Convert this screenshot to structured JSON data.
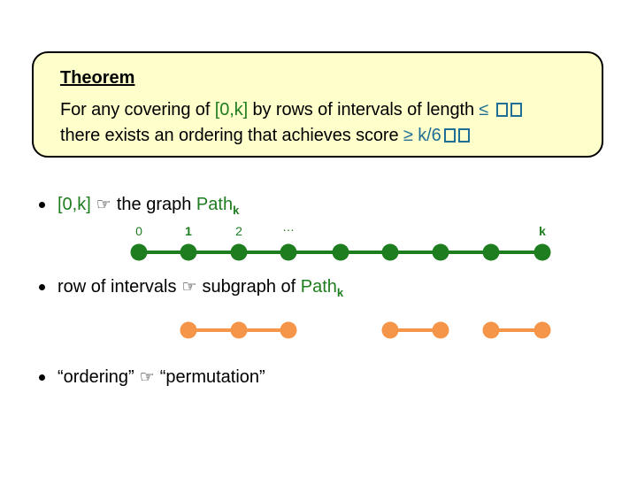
{
  "theorem": {
    "title": "Theorem",
    "line1_prefix": "For any covering of ",
    "line1_interval": "[0,k]",
    "line1_mid": " by rows of intervals of length ",
    "line1_bound": "≤ ",
    "line1_suffix": ",",
    "line2_prefix": "there exists an ordering that achieves score ",
    "line2_bound": "≥ k/6"
  },
  "bullets": [
    {
      "left": "[0,k]",
      "arrow": "☞",
      "right_prefix": "the graph ",
      "right_term": "Path",
      "right_sub": "k"
    },
    {
      "left": "row of intervals",
      "arrow": "☞",
      "right_prefix": "subgraph of ",
      "right_term": "Path",
      "right_sub": "k"
    },
    {
      "left": "“ordering”",
      "arrow": "☞",
      "right_prefix": "“permutation”",
      "right_term": "",
      "right_sub": ""
    }
  ],
  "path_graph": {
    "color": "#1E7D1E",
    "node_count": 9,
    "labels": [
      "0",
      "1",
      "2",
      "…",
      "",
      "",
      "",
      "",
      "k"
    ]
  },
  "subgraph": {
    "color": "#F5954A",
    "segments": [
      [
        1,
        2,
        3
      ],
      [
        5,
        6
      ],
      [
        7,
        8
      ]
    ]
  },
  "colors": {
    "box_fill": "#FFFFCC",
    "green": "#1E7D1E",
    "blue": "#1F6E96",
    "orange": "#F5954A"
  }
}
